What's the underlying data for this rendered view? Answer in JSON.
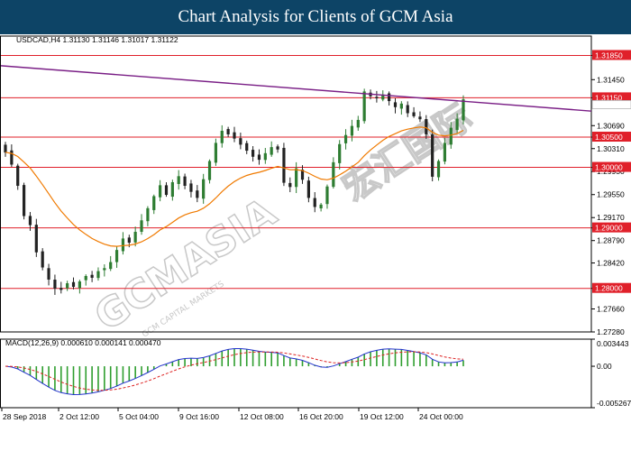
{
  "banner": {
    "title": "Chart Analysis for Clients of GCM Asia"
  },
  "main_chart": {
    "info": "USDCAD,H4  1.31130 1.31146 1.31017 1.31122",
    "price_ticks": [
      "1.31850",
      "1.31450",
      "1.31150",
      "1.30690",
      "1.30500",
      "1.30310",
      "1.30000",
      "1.29930",
      "1.29550",
      "1.29170",
      "1.29000",
      "1.28790",
      "1.28420",
      "1.28000",
      "1.27660",
      "1.27280"
    ],
    "hlines": [
      {
        "price": 1.3185,
        "label": "1.31850"
      },
      {
        "price": 1.3115,
        "label": "1.31150"
      },
      {
        "price": 1.305,
        "label": "1.30500"
      },
      {
        "price": 1.3,
        "label": "1.30000"
      },
      {
        "price": 1.29,
        "label": "1.29000"
      },
      {
        "price": 1.28,
        "label": "1.28000"
      }
    ],
    "current_price": "1.31122",
    "line_colors": {
      "support": "#e0202a",
      "trend": "#7a1f86",
      "ma": "#f07a00",
      "bull": "#2e7d32",
      "bear": "#222222"
    }
  },
  "macd": {
    "info": "MACD(12,26,9) 0.000610 0.000141 0.000470",
    "ticks": [
      "0.003443",
      "0.00",
      "-0.005267"
    ],
    "colors": {
      "hist": "#2e9e2e",
      "macd": "#2233cc",
      "signal": "#dd2222"
    }
  },
  "x_axis": {
    "labels": [
      "28 Sep 2018",
      "2 Oct 12:00",
      "5 Oct 04:00",
      "9 Oct 16:00",
      "12 Oct 08:00",
      "16 Oct 20:00",
      "19 Oct 12:00",
      "24 Oct 00:00"
    ]
  },
  "watermark": {
    "text": "GCMASIA",
    "sub": "GCM CAPITAL MARKETS",
    "cn": "宏汇国际"
  },
  "chart_data": [
    {
      "type": "candlestick",
      "title": "USDCAD,H4",
      "ylim": [
        1.2728,
        1.3217
      ],
      "close": [
        1.3025,
        1.3005,
        1.297,
        1.292,
        1.2905,
        1.286,
        1.2835,
        1.2815,
        1.28,
        1.2798,
        1.2808,
        1.2803,
        1.2811,
        1.282,
        1.2818,
        1.2828,
        1.2833,
        1.2843,
        1.2863,
        1.2882,
        1.2876,
        1.2893,
        1.2912,
        1.2932,
        1.2952,
        1.297,
        1.2955,
        1.2975,
        1.2985,
        1.297,
        1.296,
        1.295,
        1.298,
        1.301,
        1.304,
        1.306,
        1.3055,
        1.3048,
        1.3038,
        1.3028,
        1.3018,
        1.3013,
        1.3023,
        1.3033,
        1.303,
        1.2975,
        1.2968,
        1.2998,
        1.298,
        1.295,
        1.2935,
        1.2938,
        1.2968,
        1.3008,
        1.3038,
        1.3053,
        1.3068,
        1.3078,
        1.3125,
        1.3118,
        1.3115,
        1.312,
        1.311,
        1.31,
        1.3105,
        1.309,
        1.3085,
        1.308,
        1.3055,
        1.2985,
        1.301,
        1.304,
        1.3065,
        1.308,
        1.3112
      ],
      "ma_color": "#f07a00",
      "trendline": {
        "from": 1.3168,
        "to": 1.3093
      }
    },
    {
      "type": "bar+line",
      "title": "MACD(12,26,9)",
      "ylim": [
        -0.005267,
        0.003443
      ],
      "series": [
        {
          "name": "",
          "kind": "histogram",
          "values": []
        },
        {
          "name": "",
          "kind": "line",
          "values": []
        }
      ]
    }
  ]
}
